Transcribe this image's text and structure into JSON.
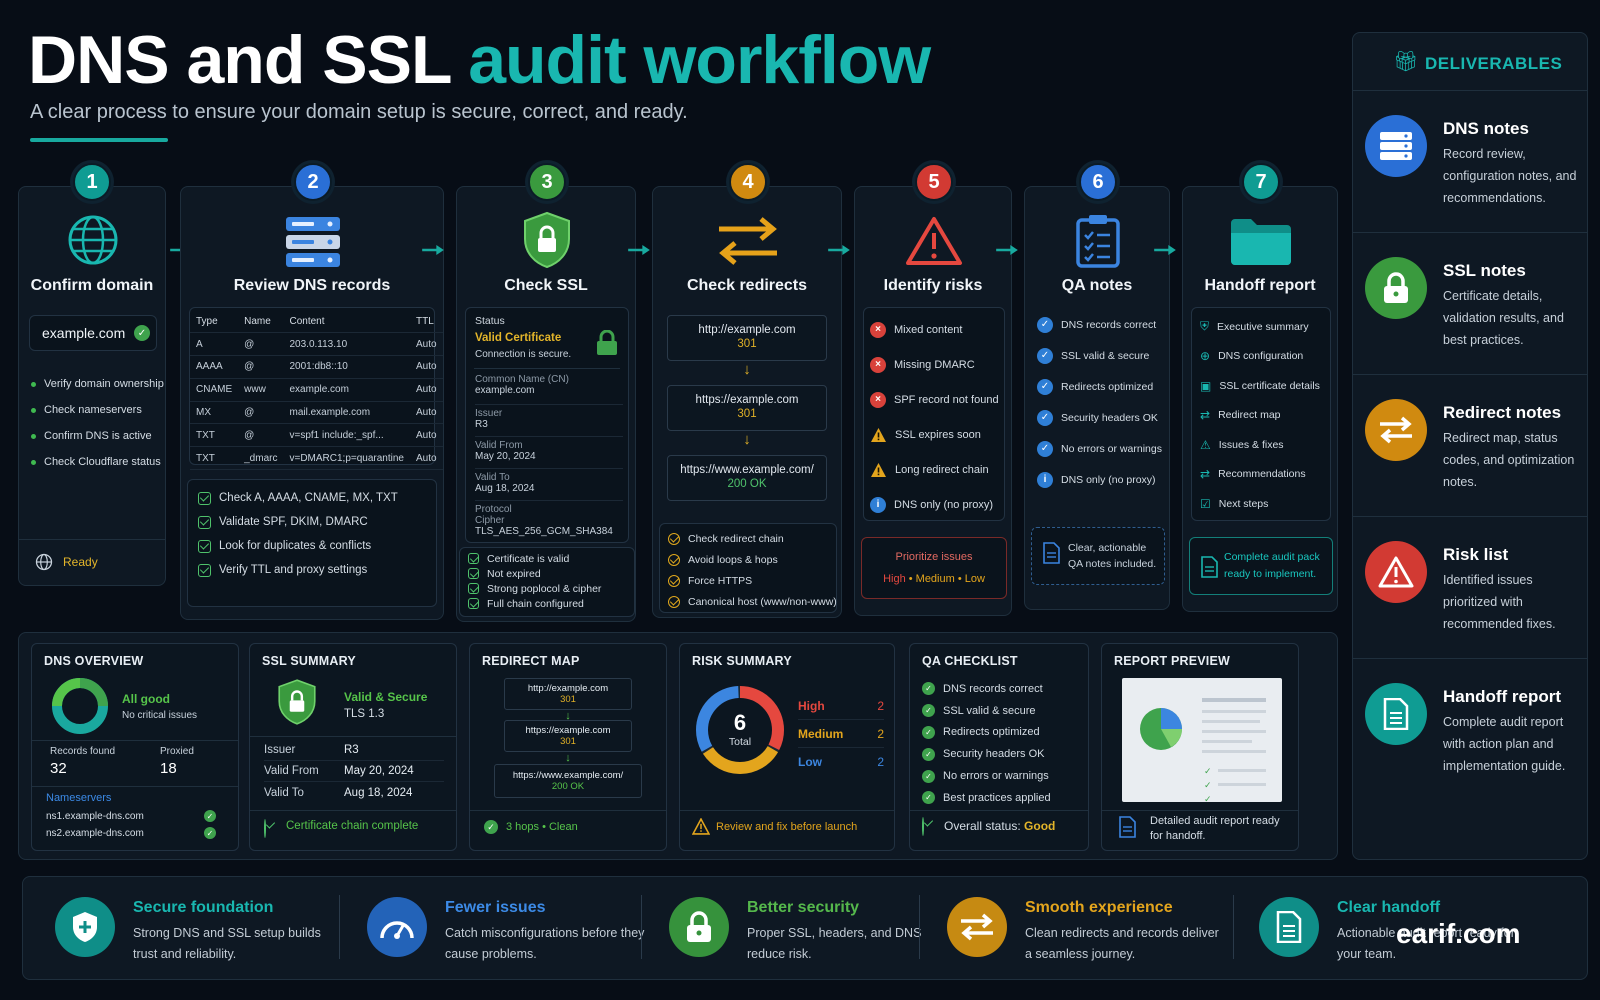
{
  "header": {
    "title_main": "DNS and SSL",
    "title_accent": "audit workflow",
    "subtitle": "A clear process to ensure your domain setup is secure, correct, and ready."
  },
  "steps": [
    {
      "num": "1",
      "title": "Confirm domain",
      "color": "#0f9c93",
      "domain": "example.com",
      "items": [
        "Verify domain ownership",
        "Check nameservers",
        "Confirm DNS is active",
        "Check Cloudflare status"
      ],
      "status": "Ready"
    },
    {
      "num": "2",
      "title": "Review DNS records",
      "color": "#2a6fd6",
      "table_headers": [
        "Type",
        "Name",
        "Content",
        "TTL"
      ],
      "rows": [
        [
          "A",
          "@",
          "203.0.113.10",
          "Auto"
        ],
        [
          "AAAA",
          "@",
          "2001:db8::10",
          "Auto"
        ],
        [
          "CNAME",
          "www",
          "example.com",
          "Auto"
        ],
        [
          "MX",
          "@",
          "mail.example.com",
          "Auto"
        ],
        [
          "TXT",
          "@",
          "v=spf1 include:_spf...",
          "Auto"
        ],
        [
          "TXT",
          "_dmarc",
          "v=DMARC1;p=quarantine",
          "Auto"
        ]
      ],
      "checks": [
        "Check A, AAAA, CNAME, MX, TXT",
        "Validate SPF, DKIM, DMARC",
        "Look for duplicates & conflicts",
        "Verify TTL and proxy settings"
      ]
    },
    {
      "num": "3",
      "title": "Check SSL",
      "color": "#3a9a3e",
      "status_label": "Status",
      "status_value": "Valid Certificate",
      "status_note": "Connection is secure.",
      "fields": [
        {
          "label": "Common Name (CN)",
          "value": "example.com"
        },
        {
          "label": "Issuer",
          "value": "R3"
        },
        {
          "label": "Valid From",
          "value": "May 20, 2024"
        },
        {
          "label": "Valid To",
          "value": "Aug 18, 2024"
        },
        {
          "label": "Protocol",
          "value": ""
        },
        {
          "label": "Cipher",
          "value": "TLS_AES_256_GCM_SHA384"
        }
      ],
      "checks": [
        "Certificate is valid",
        "Not expired",
        "Strong poplocol & cipher",
        "Full chain configured"
      ]
    },
    {
      "num": "4",
      "title": "Check redirects",
      "color": "#d08a10",
      "chain": [
        {
          "url": "http://example.com",
          "code": "301"
        },
        {
          "url": "https://example.com",
          "code": "301"
        },
        {
          "url": "https://www.example.com/",
          "code": "200 OK"
        }
      ],
      "checks": [
        "Check redirect chain",
        "Avoid loops & hops",
        "Force HTTPS",
        "Canonical host (www/non-www)"
      ]
    },
    {
      "num": "5",
      "title": "Identify risks",
      "color": "#d23a33",
      "risks": [
        {
          "type": "error",
          "text": "Mixed content"
        },
        {
          "type": "error",
          "text": "Missing DMARC"
        },
        {
          "type": "error",
          "text": "SPF record not found"
        },
        {
          "type": "warn",
          "text": "SSL expires soon"
        },
        {
          "type": "warn",
          "text": "Long redirect chain"
        },
        {
          "type": "info",
          "text": "DNS only (no proxy)"
        }
      ],
      "prioritize": "Prioritize issues",
      "levels": [
        "High",
        "Medium",
        "Low"
      ]
    },
    {
      "num": "6",
      "title": "QA notes",
      "color": "#2a6fd6",
      "items": [
        "DNS records correct",
        "SSL valid & secure",
        "Redirects optimized",
        "Security headers OK",
        "No errors or warnings",
        "DNS only (no proxy)"
      ],
      "note": "Clear, actionable QA notes included."
    },
    {
      "num": "7",
      "title": "Handoff report",
      "color": "#0f9c93",
      "items": [
        "Executive summary",
        "DNS configuration",
        "SSL certificate details",
        "Redirect map",
        "Issues & fixes",
        "Recommendations",
        "Next steps"
      ],
      "note": "Complete audit pack ready to implement."
    }
  ],
  "dns_overview": {
    "title": "DNS OVERVIEW",
    "status": "All good",
    "status_note": "No critical issues",
    "records_label": "Records found",
    "records_value": "32",
    "proxied_label": "Proxied",
    "proxied_value": "18",
    "ns_label": "Nameservers",
    "nameservers": [
      "ns1.example-dns.com",
      "ns2.example-dns.com"
    ]
  },
  "ssl_summary": {
    "title": "SSL SUMMARY",
    "status": "Valid & Secure",
    "protocol": "TLS 1.3",
    "rows": [
      [
        "Issuer",
        "R3"
      ],
      [
        "Valid From",
        "May 20, 2024"
      ],
      [
        "Valid To",
        "Aug 18, 2024"
      ]
    ],
    "footer": "Certificate chain complete"
  },
  "redirect_map": {
    "title": "REDIRECT MAP",
    "chain": [
      {
        "url": "http://example.com",
        "code": "301"
      },
      {
        "url": "https://example.com",
        "code": "301"
      },
      {
        "url": "https://www.example.com/",
        "code": "200 OK"
      }
    ],
    "footer": "3 hops • Clean"
  },
  "risk_summary": {
    "title": "RISK SUMMARY",
    "total": "6",
    "total_label": "Total",
    "rows": [
      {
        "label": "High",
        "value": 2,
        "color": "#e5483f"
      },
      {
        "label": "Medium",
        "value": 2,
        "color": "#e3a51d"
      },
      {
        "label": "Low",
        "value": 2,
        "color": "#3c86e0"
      }
    ],
    "footer": "Review and fix before launch"
  },
  "qa_checklist": {
    "title": "QA CHECKLIST",
    "items": [
      "DNS records correct",
      "SSL valid & secure",
      "Redirects optimized",
      "Security headers OK",
      "No errors or warnings",
      "Best practices applied"
    ],
    "overall_label": "Overall status:",
    "overall_value": "Good"
  },
  "report_preview": {
    "title": "REPORT PREVIEW",
    "footer": "Detailed audit report ready for handoff."
  },
  "deliverables": {
    "title": "DELIVERABLES",
    "items": [
      {
        "title": "DNS notes",
        "text": "Record review, configuration notes, and recommendations.",
        "color": "#2a6fd6",
        "icon": "server-icon"
      },
      {
        "title": "SSL notes",
        "text": "Certificate details, validation results, and best practices.",
        "color": "#3a9a3e",
        "icon": "lock-icon"
      },
      {
        "title": "Redirect notes",
        "text": "Redirect map, status codes, and optimization notes.",
        "color": "#d08a10",
        "icon": "redirect-arrows-icon"
      },
      {
        "title": "Risk list",
        "text": "Identified issues prioritized with recommended fixes.",
        "color": "#d23a33",
        "icon": "warning-icon"
      },
      {
        "title": "Handoff report",
        "text": "Complete audit report with action plan and implementation guide.",
        "color": "#0f9c93",
        "icon": "document-icon"
      }
    ]
  },
  "benefits": [
    {
      "title": "Secure foundation",
      "text": "Strong DNS and SSL setup builds trust and reliability.",
      "color": "#19b7b0",
      "icon_bg": "#0f8e88"
    },
    {
      "title": "Fewer issues",
      "text": "Catch misconfigurations before they cause problems.",
      "color": "#3c8ae6",
      "icon_bg": "#2363b8"
    },
    {
      "title": "Better security",
      "text": "Proper SSL, headers, and DNS reduce risk.",
      "color": "#55b84c",
      "icon_bg": "#36923c"
    },
    {
      "title": "Smooth experience",
      "text": "Clean redirects and records deliver a seamless journey.",
      "color": "#e3a51d",
      "icon_bg": "#c68a12"
    },
    {
      "title": "Clear handoff",
      "text": "Actionable audit report ready for your team.",
      "color": "#19b7b0",
      "icon_bg": "#0f8e88"
    }
  ],
  "watermark": "earif.com"
}
